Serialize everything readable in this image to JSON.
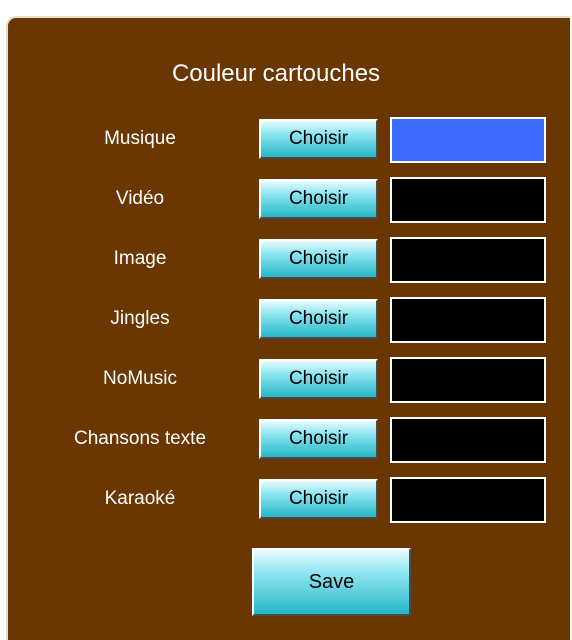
{
  "panel": {
    "title": "Couleur cartouches",
    "choose_label": "Choisir",
    "save_label": "Save",
    "rows": [
      {
        "label": "Musique",
        "color": "#3d6dff"
      },
      {
        "label": "Vidéo",
        "color": "#000000"
      },
      {
        "label": "Image",
        "color": "#000000"
      },
      {
        "label": "Jingles",
        "color": "#000000"
      },
      {
        "label": "NoMusic",
        "color": "#000000"
      },
      {
        "label": "Chansons texte",
        "color": "#000000"
      },
      {
        "label": "Karaoké",
        "color": "#000000"
      }
    ]
  },
  "colors": {
    "panel_background": "#6a3602",
    "button_accent": "#27b7c7"
  }
}
